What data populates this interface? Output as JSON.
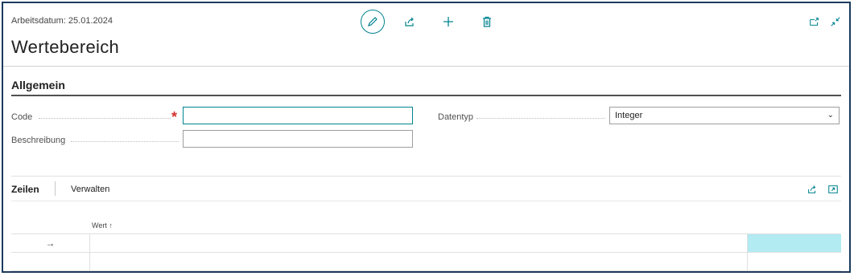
{
  "header": {
    "work_date": "Arbeitsdatum: 25.01.2024",
    "title": "Wertebereich"
  },
  "actions": {
    "edit": "pencil-icon",
    "share": "share-icon",
    "new": "plus-icon",
    "delete": "trash-icon",
    "open_new_window": "open-in-new-window-icon",
    "collapse": "collapse-icon"
  },
  "section": {
    "title": "Allgemein",
    "fields": {
      "code": {
        "label": "Code",
        "value": "",
        "required": "*"
      },
      "beschreibung": {
        "label": "Beschreibung",
        "value": ""
      },
      "datentyp": {
        "label": "Datentyp",
        "value": "Integer"
      }
    }
  },
  "subpage": {
    "tab_active": "Zeilen",
    "tab_manage": "Verwalten",
    "column_header": "Wert ↑",
    "row_indicator": "→",
    "rows": [
      {
        "wert": ""
      },
      {
        "wert": ""
      }
    ]
  },
  "colors": {
    "accent": "#00838f",
    "frame": "#1b3a5c",
    "active_cell": "#b2ebf2",
    "required": "#d32f2f"
  }
}
